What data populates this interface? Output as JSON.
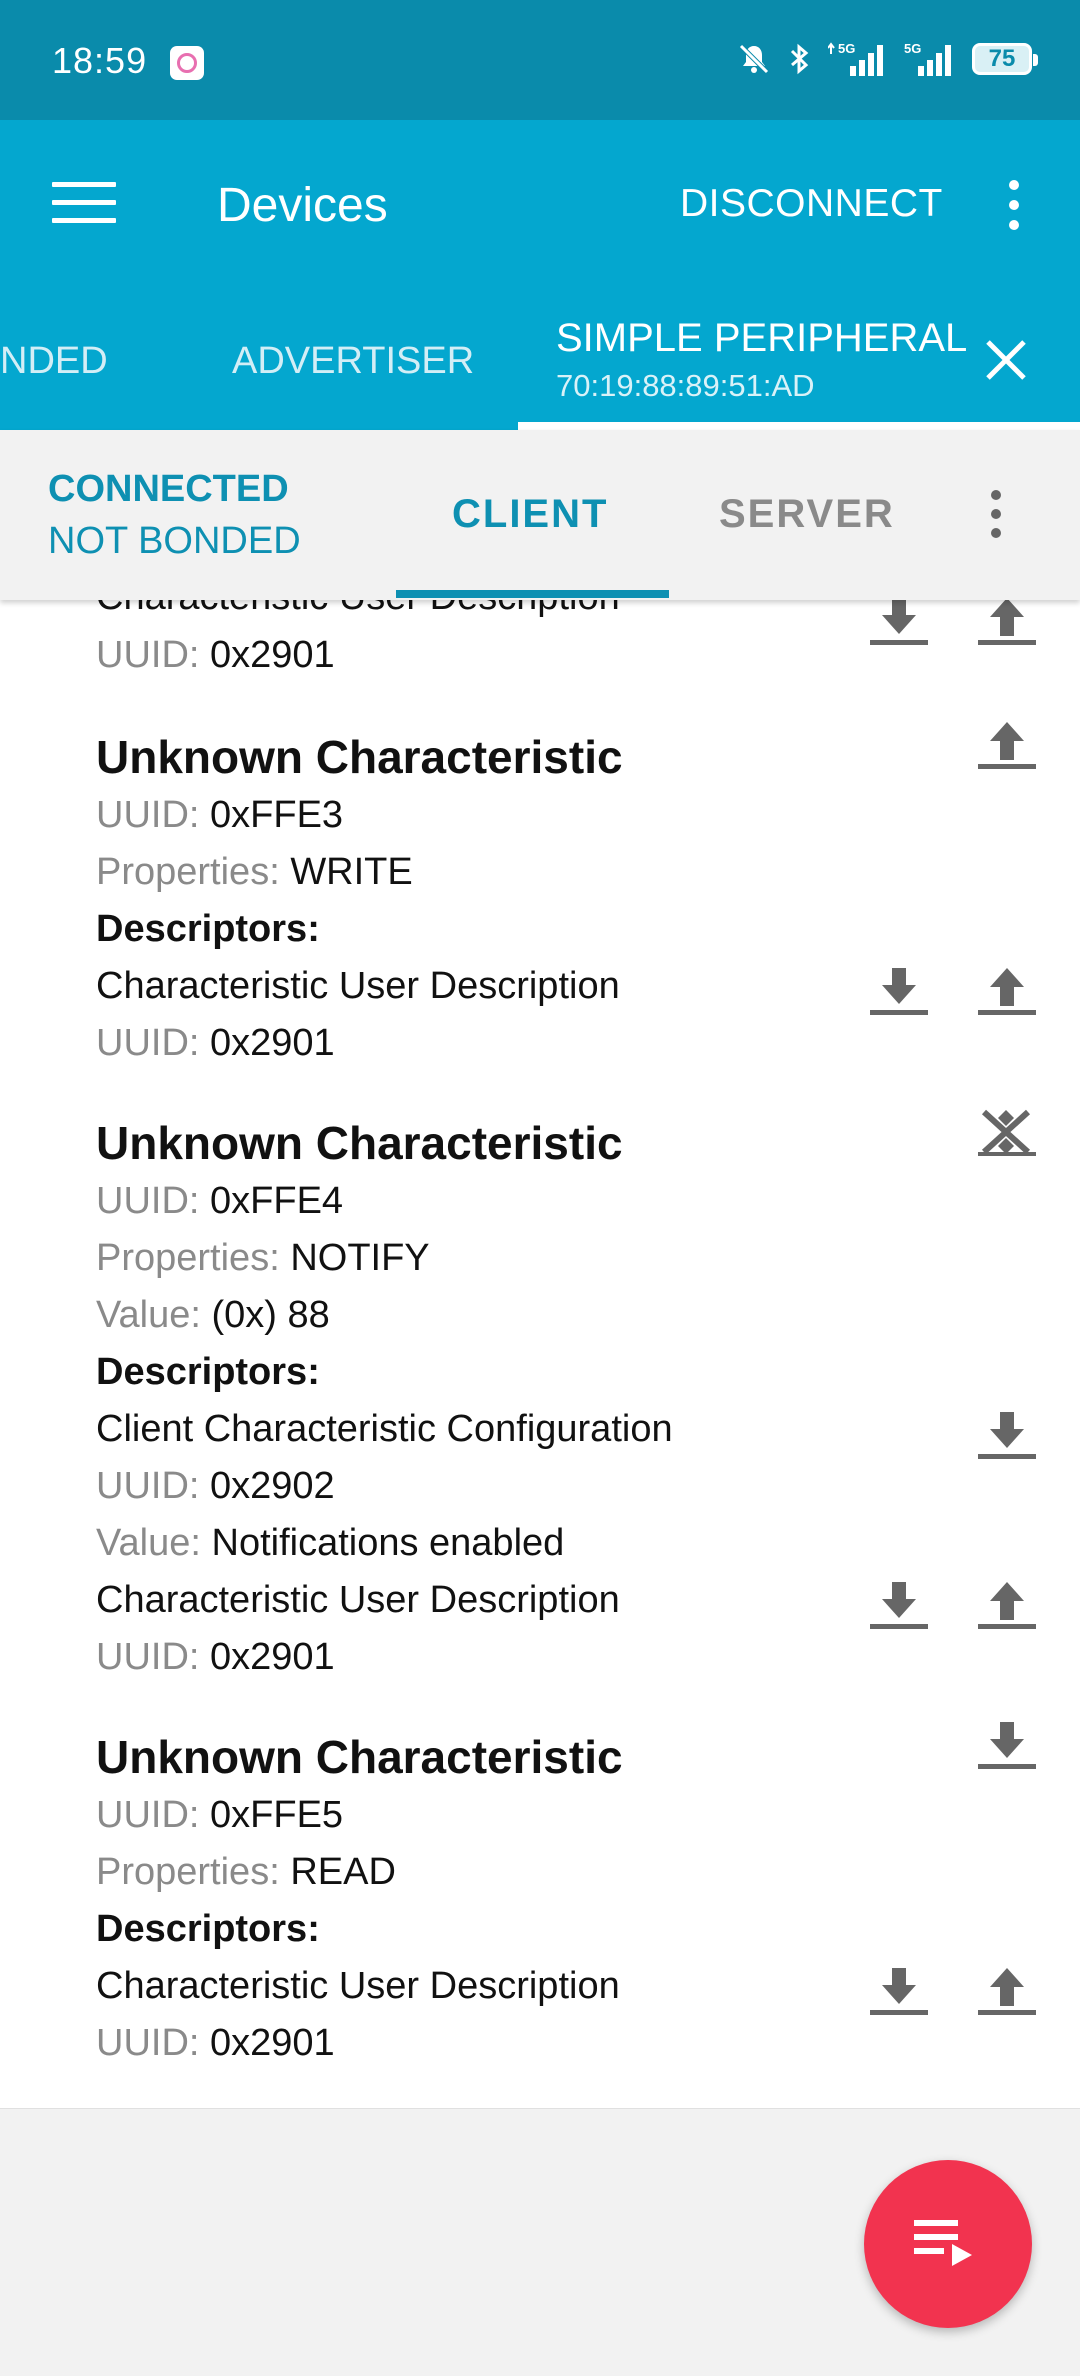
{
  "status_bar": {
    "time": "18:59",
    "battery": "75",
    "icons": [
      "app-icon",
      "mute-icon",
      "bluetooth-icon",
      "signal-5g-icon",
      "signal-5g-icon",
      "battery-icon"
    ]
  },
  "app_bar": {
    "title": "Devices",
    "disconnect_label": "DISCONNECT"
  },
  "device_tabs": {
    "bonded": "NDED",
    "advertiser": "ADVERTISER",
    "peripheral_name": "SIMPLE PERIPHERAL",
    "peripheral_address": "70:19:88:89:51:AD"
  },
  "connection": {
    "state": "CONNECTED",
    "bond_state": "NOT BONDED",
    "tab_client": "CLIENT",
    "tab_server": "SERVER"
  },
  "labels": {
    "uuid": "UUID:",
    "properties": "Properties:",
    "value": "Value:",
    "descriptors": "Descriptors:"
  },
  "content": {
    "partial_descriptor": {
      "name": "Characteristic User Description",
      "uuid": "0x2901"
    },
    "characteristics": [
      {
        "name": "Unknown Characteristic",
        "uuid": "0xFFE3",
        "properties": "WRITE",
        "descriptors": [
          {
            "name": "Characteristic User Description",
            "uuid": "0x2901"
          }
        ]
      },
      {
        "name": "Unknown Characteristic",
        "uuid": "0xFFE4",
        "properties": "NOTIFY",
        "value": "(0x) 88",
        "descriptors": [
          {
            "name": "Client Characteristic Configuration",
            "uuid": "0x2902",
            "value": "Notifications enabled"
          },
          {
            "name": "Characteristic User Description",
            "uuid": "0x2901"
          }
        ]
      },
      {
        "name": "Unknown Characteristic",
        "uuid": "0xFFE5",
        "properties": "READ",
        "descriptors": [
          {
            "name": "Characteristic User Description",
            "uuid": "0x2901"
          }
        ]
      }
    ]
  },
  "colors": {
    "status_bar": "#0a8bab",
    "app_bar": "#04a7cf",
    "accent": "#0e90b2",
    "fab": "#f2334f"
  }
}
